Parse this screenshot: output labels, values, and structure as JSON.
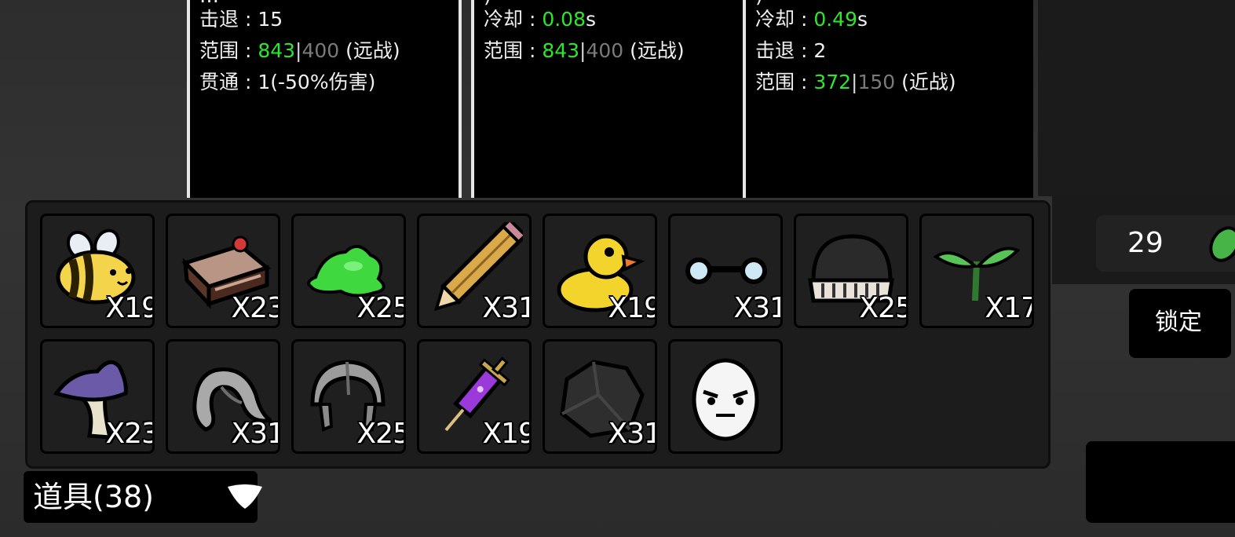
{
  "weapon_panels": [
    {
      "cut_top": "…",
      "lines": [
        {
          "label": "击退 : ",
          "value": "15"
        },
        {
          "label": "范围 : ",
          "value": "843",
          "sep": "|",
          "base": "400",
          "suffix": " (远战)"
        },
        {
          "label": "贯通 : ",
          "value": "1(-50%伤害)"
        }
      ]
    },
    {
      "cut_top": ")",
      "lines": [
        {
          "label": "冷却 : ",
          "value": "0.08",
          "suffix": "s"
        },
        {
          "label": "范围 : ",
          "value": "843",
          "sep": "|",
          "base": "400",
          "suffix": " (远战)"
        }
      ]
    },
    {
      "cut_top": ")",
      "lines": [
        {
          "label": "冷却 : ",
          "value": "0.49",
          "suffix": "s"
        },
        {
          "label": "击退 : ",
          "value": "2"
        },
        {
          "label": "范围 : ",
          "value": "372",
          "sep": "|",
          "base": "150",
          "suffix": " (近战)"
        }
      ]
    }
  ],
  "inventory": {
    "items": [
      {
        "icon": "bee-icon",
        "count": "X19"
      },
      {
        "icon": "cake-slice-icon",
        "count": "X23"
      },
      {
        "icon": "green-slime-icon",
        "count": "X25"
      },
      {
        "icon": "pencil-icon",
        "count": "X31"
      },
      {
        "icon": "rubber-duck-icon",
        "count": "X19"
      },
      {
        "icon": "glasses-icon",
        "count": "X31"
      },
      {
        "icon": "beanie-hat-icon",
        "count": "X25"
      },
      {
        "icon": "sprout-icon",
        "count": "X17"
      },
      {
        "icon": "purple-mushroom-icon",
        "count": "X23"
      },
      {
        "icon": "grey-scarf-icon",
        "count": "X31"
      },
      {
        "icon": "helmet-icon",
        "count": "X25"
      },
      {
        "icon": "syringe-icon",
        "count": "X19"
      },
      {
        "icon": "coal-rock-icon",
        "count": "X31"
      },
      {
        "icon": "angry-egg-icon",
        "count": ""
      }
    ]
  },
  "dropdown": {
    "label": "道具(38)",
    "icon": "triangle-down-icon"
  },
  "currency": {
    "value": "29",
    "icon": "green-material-icon"
  },
  "lock_button": {
    "label": "锁定"
  },
  "colors": {
    "green": "#2ee62e",
    "dim": "#7a7a7a",
    "panel_bg": "#1c1c1c"
  }
}
